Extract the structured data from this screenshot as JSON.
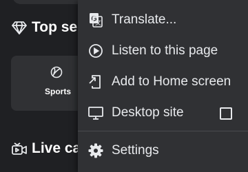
{
  "background": {
    "top_section_title": "Top se",
    "sports_label": "Sports",
    "live_section_title": "Live ca"
  },
  "menu": {
    "translate": "Translate...",
    "listen": "Listen to this page",
    "add_home": "Add to Home screen",
    "desktop_site": "Desktop site",
    "desktop_site_checked": false,
    "settings": "Settings"
  },
  "colors": {
    "page_bg": "#1f2023",
    "menu_bg": "#303134",
    "text": "#e8eaed"
  }
}
